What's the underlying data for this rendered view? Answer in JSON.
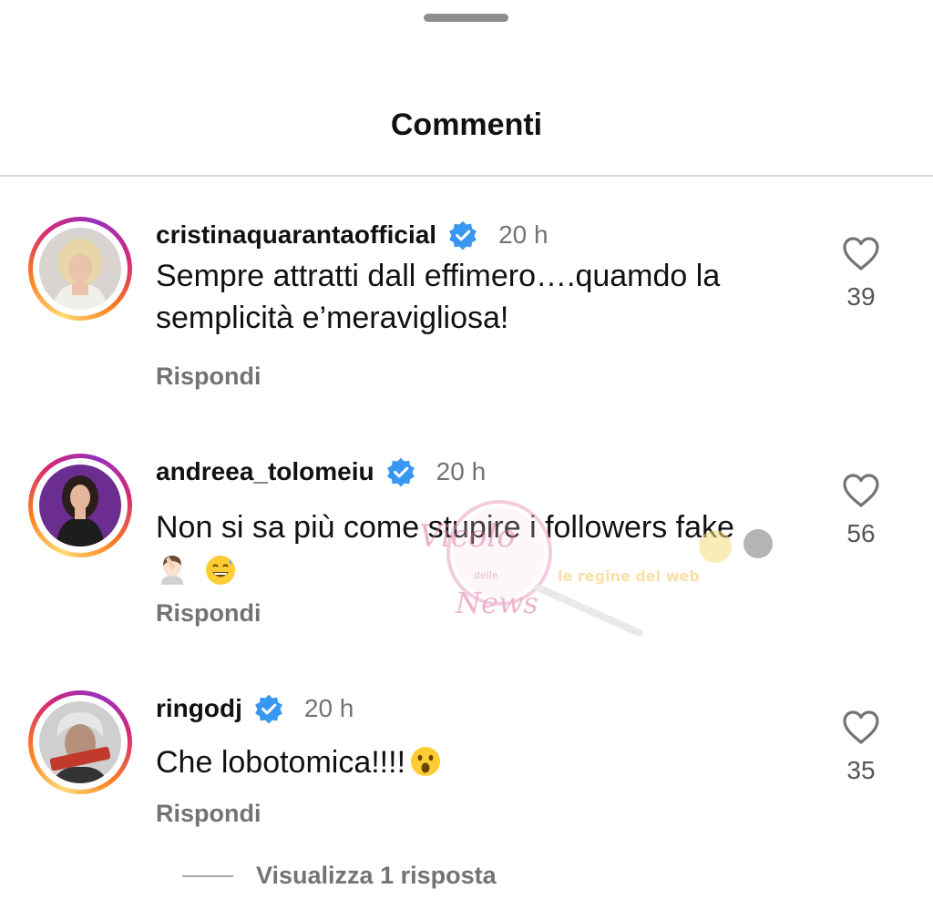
{
  "header": {
    "title": "Commenti"
  },
  "comments": [
    {
      "username": "cristinaquarantaofficial",
      "time": "20 h",
      "text_line1": "Sempre attratti dall effimero….quamdo la",
      "text_line2": "semplicità e’meravigliosa!",
      "reply_label": "Rispondi",
      "likes": "39",
      "verified": true
    },
    {
      "username": "andreea_tolomeiu",
      "time": "20 h",
      "text_line1": "Non si sa più come stupire i followers fake",
      "emojis": [
        "facepalm-woman",
        "sweat-smile"
      ],
      "reply_label": "Rispondi",
      "likes": "56",
      "verified": true
    },
    {
      "username": "ringodj",
      "time": "20 h",
      "text_line1": "Che lobotomica!!!!",
      "emojis": [
        "astonished-face"
      ],
      "reply_label": "Rispondi",
      "likes": "35",
      "verified": true
    }
  ],
  "view_replies": {
    "label": "Visualizza 1 risposta"
  },
  "watermark": {
    "text1": "Vicolo",
    "text2": "delle",
    "text3": "News",
    "text4": "le regine del web"
  },
  "colors": {
    "verified": "#3897f0",
    "secondary_text": "#737373",
    "divider": "#dbdbdb",
    "handle": "#8e8e8e"
  }
}
